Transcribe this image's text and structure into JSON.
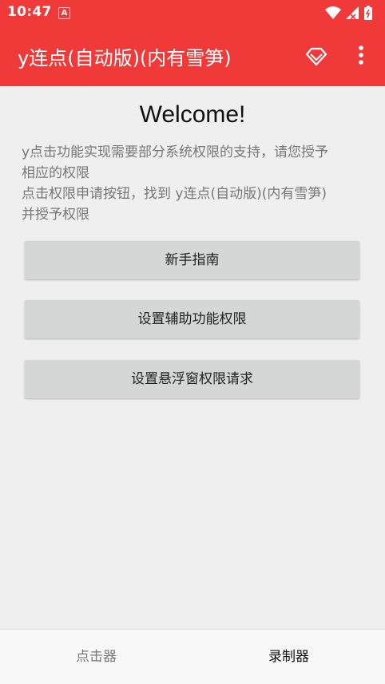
{
  "status_bar": {
    "time": "10:47",
    "notification_icon": "A",
    "icons": [
      "wifi-icon",
      "signal-icon",
      "battery-icon"
    ]
  },
  "app_bar": {
    "title": "y连点(自动版)(内有雪笋)",
    "actions": [
      "diamond-icon",
      "more-vert-icon"
    ],
    "background": "#f03a3a"
  },
  "main": {
    "welcome": "Welcome!",
    "description_lines": [
      "y点击功能实现需要部分系统权限的支持，请您授予",
      "相应的权限",
      "点击权限申请按钮，找到 y连点(自动版)(内有雪笋)",
      "并授予权限"
    ],
    "buttons": {
      "guide": "新手指南",
      "accessibility": "设置辅助功能权限",
      "overlay": "设置悬浮窗权限请求"
    }
  },
  "bottom_nav": {
    "items": [
      {
        "label": "点击器",
        "selected": false
      },
      {
        "label": "录制器",
        "selected": true
      }
    ]
  }
}
